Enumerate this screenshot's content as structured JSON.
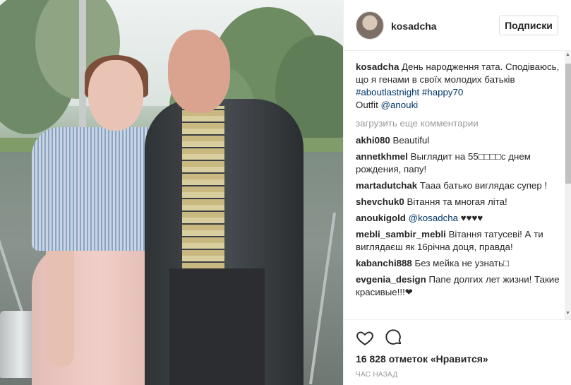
{
  "post": {
    "username": "kosadcha",
    "follow_label": "Подписки",
    "caption": {
      "author": "kosadcha",
      "text": "День народження тата. Сподіваюсь, що я генами в своїх молодих батьків",
      "hashtags": [
        "#aboutlastnight",
        "#happy70"
      ],
      "outfit_prefix": "Outfit",
      "outfit_mention": "@anouki"
    },
    "load_more_label": "загрузить еще комментарии",
    "comments": [
      {
        "author": "akhi080",
        "text": "Beautiful"
      },
      {
        "author": "annetkhmel",
        "text": "Выглядит на 55□□□□с днем рождения, папу!"
      },
      {
        "author": "martadutchak",
        "text": "Тааа батько виглядає супер !"
      },
      {
        "author": "shevchuk0",
        "text": "Вітання та многая літа!"
      },
      {
        "author": "anoukigold",
        "mention": "@kosadcha",
        "text": "♥♥♥♥"
      },
      {
        "author": "mebli_sambir_mebli",
        "text": "Вітання татусеві! А ти виглядаєш як 16річна доця, правда!"
      },
      {
        "author": "kabanchi888",
        "text": "Без мейка не узнать□"
      },
      {
        "author": "evgenia_design",
        "text": "Папе долгих лет жизни! Такие красивые!!!❤"
      }
    ],
    "likes": "16 828 отметок «Нравится»",
    "time_ago": "ЧАС НАЗАД"
  },
  "icons": {
    "like": "heart-icon",
    "comment": "comment-icon"
  },
  "colors": {
    "link": "#003569",
    "muted": "#999999",
    "text": "#262626"
  }
}
